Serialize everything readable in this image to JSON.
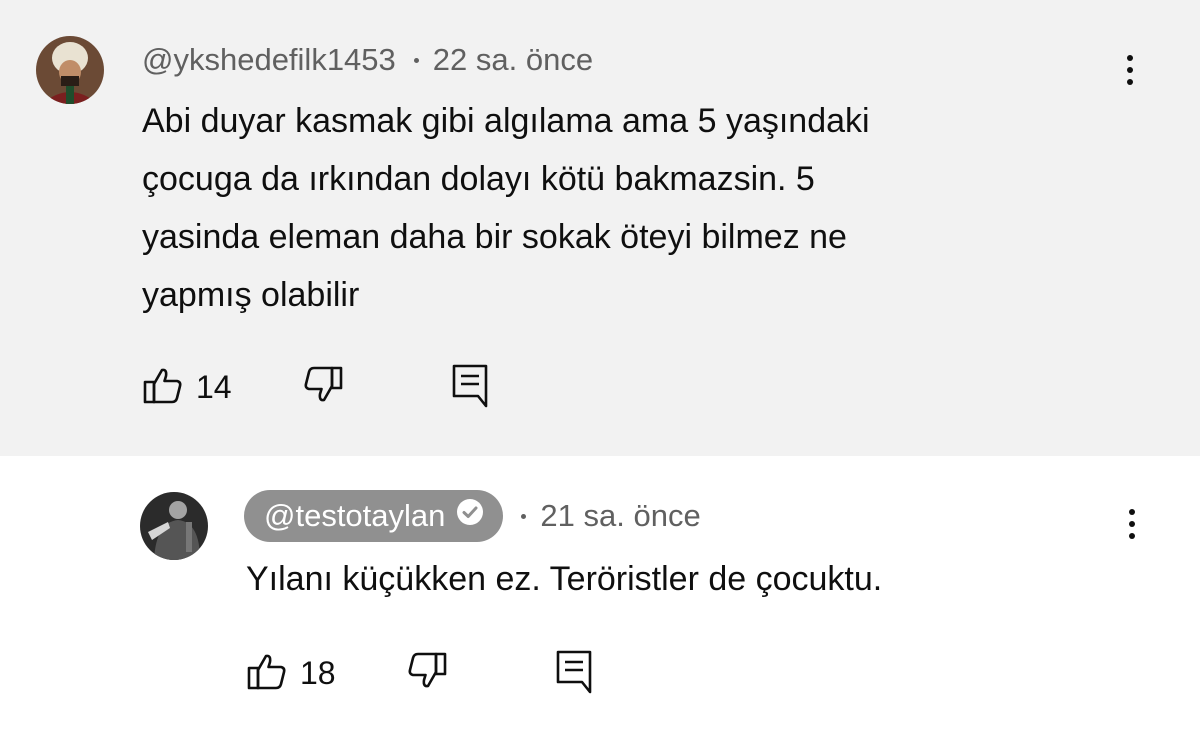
{
  "comments": [
    {
      "handle": "@ykshedefilk1453",
      "time": "22 sa. önce",
      "text": "Abi duyar kasmak gibi algılama ama 5 yaşındaki\nçocuga da ırkından dolayı kötü bakmazsin. 5\nyasinda eleman daha bir sokak öteyi bilmez ne\nyapmış olabilir",
      "likes": "14",
      "avatar_icon": "user-avatar-icon"
    },
    {
      "handle": "@testotaylan",
      "time": "21 sa. önce",
      "text": "Yılanı küçükken ez. Teröristler de çocuktu.",
      "likes": "18",
      "avatar_icon": "user-avatar-icon",
      "verified": true
    }
  ],
  "icons": {
    "like": "thumbs-up-icon",
    "dislike": "thumbs-down-icon",
    "reply": "reply-icon",
    "more": "more-options-icon",
    "verified": "verified-check-icon"
  },
  "colors": {
    "highlight_bg": "#f2f2f2",
    "meta_text": "#606060",
    "pill_bg": "#909090",
    "text": "#0f0f0f"
  }
}
